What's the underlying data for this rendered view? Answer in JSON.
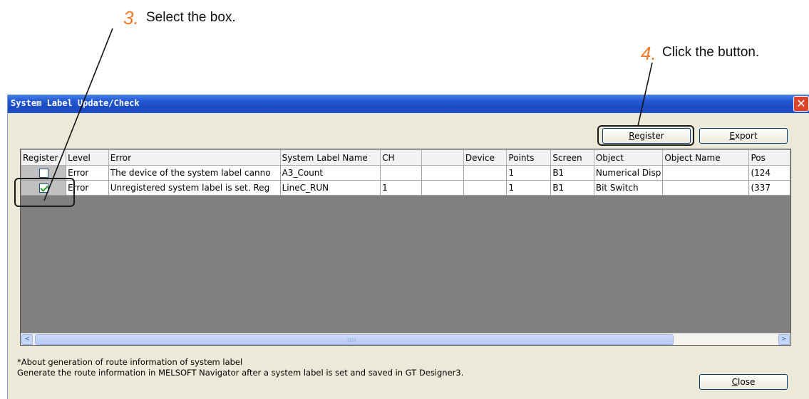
{
  "callouts": {
    "step3": {
      "num": "3.",
      "text": "Select the box."
    },
    "step4": {
      "num": "4.",
      "text": "Click the button."
    }
  },
  "window": {
    "title": "System Label Update/Check",
    "close_glyph": "✕"
  },
  "toolbar": {
    "register_underlined": "R",
    "register_rest": "egister",
    "export_underlined": "E",
    "export_rest": "xport"
  },
  "grid": {
    "columns": [
      "Register",
      "Level",
      "Error",
      "System Label Name",
      "CH",
      "",
      "Device",
      "Points",
      "Screen",
      "Object",
      "Object Name",
      "Pos"
    ],
    "rows": [
      {
        "checked": false,
        "level": "Error",
        "error": "The device of the system label canno",
        "label": "A3_Count",
        "ch": "",
        "blank": "",
        "device": "",
        "points": "1",
        "screen": "B1",
        "object": "Numerical Disp",
        "object_name": "",
        "pos": "(124"
      },
      {
        "checked": true,
        "level": "Error",
        "error": "Unregistered system label is set. Reg",
        "label": "LineC_RUN",
        "ch": "1",
        "blank": "",
        "device": "",
        "points": "1",
        "screen": "B1",
        "object": "Bit Switch",
        "object_name": "",
        "pos": "(337"
      }
    ]
  },
  "scrollbar": {
    "left_arrow": "<",
    "right_arrow": ">",
    "grip": "IIII"
  },
  "footer": {
    "note_line1": "*About generation of route information of system label",
    "note_line2": " Generate the route information in MELSOFT Navigator after a system label is set and saved in GT Designer3.",
    "close_underlined": "C",
    "close_rest": "lose"
  },
  "colors": {
    "callout_number": "#f07a2a",
    "titlebar": "#1a4bc4",
    "close_button": "#d9442b",
    "grid_background": "#808080"
  }
}
